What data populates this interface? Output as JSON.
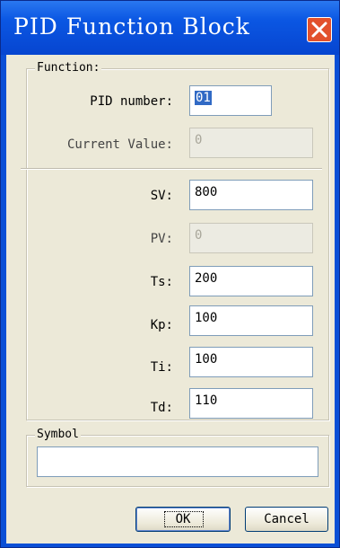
{
  "window": {
    "title": "PID Function Block"
  },
  "function_group": {
    "legend": "Function:",
    "pid_number": {
      "label": "PID number:",
      "value": "01"
    },
    "current_value": {
      "label": "Current Value:",
      "value": "0"
    }
  },
  "params": {
    "sv": {
      "label": "SV:",
      "value": "800"
    },
    "pv": {
      "label": "PV:",
      "value": "0"
    },
    "ts": {
      "label": "Ts:",
      "value": "200"
    },
    "kp": {
      "label": "Kp:",
      "value": "100"
    },
    "ti": {
      "label": "Ti:",
      "value": "100"
    },
    "td": {
      "label": "Td:",
      "value": "110"
    }
  },
  "symbol_group": {
    "legend": "Symbol",
    "value": ""
  },
  "buttons": {
    "ok": "OK",
    "cancel": "Cancel"
  }
}
